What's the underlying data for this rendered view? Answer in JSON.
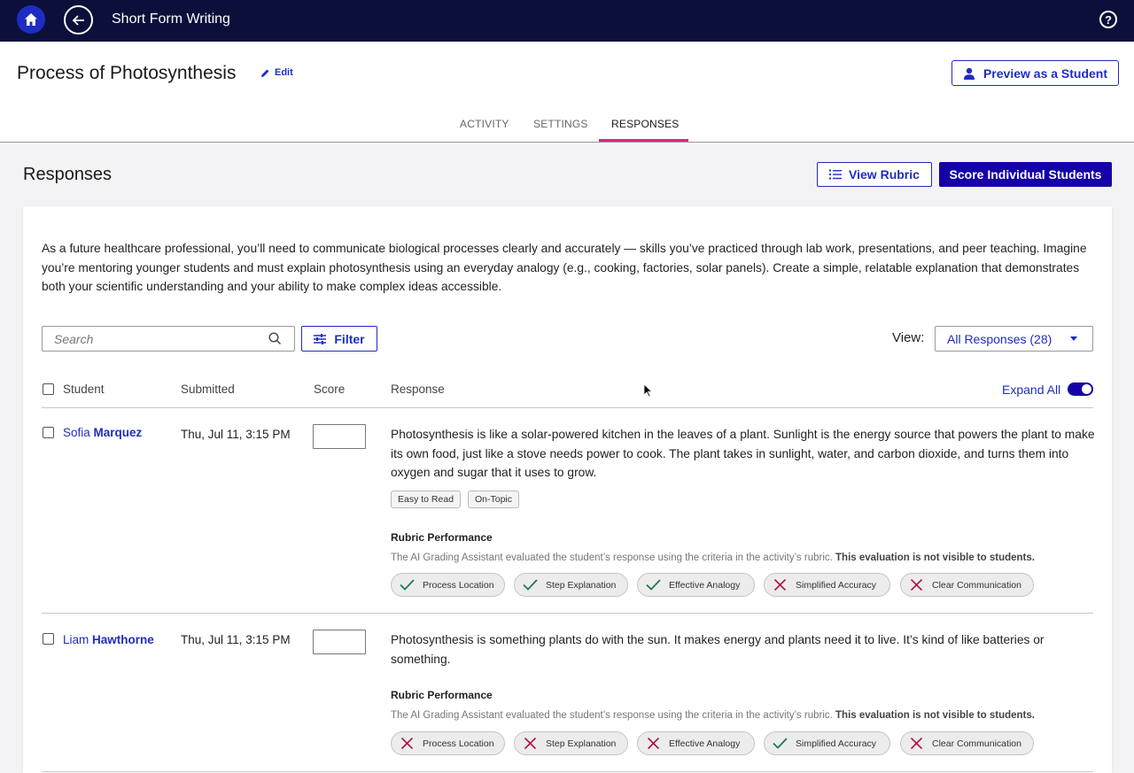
{
  "app": {
    "title": "Short Form Writing"
  },
  "header": {
    "page_title": "Process of Photosynthesis",
    "edit_label": "Edit",
    "preview_label": "Preview as a Student",
    "tabs": [
      {
        "label": "ACTIVITY"
      },
      {
        "label": "SETTINGS"
      },
      {
        "label": "RESPONSES"
      }
    ],
    "active_tab": "RESPONSES"
  },
  "responses": {
    "title": "Responses",
    "view_rubric_label": "View Rubric",
    "score_students_label": "Score Individual Students",
    "prompt": "As a future healthcare professional, you’ll need to communicate biological processes clearly and accurately — skills you’ve practiced through lab work, presentations, and peer teaching. Imagine you’re mentoring younger students and must explain photosynthesis using an everyday analogy (e.g., cooking, factories, solar panels). Create a simple, relatable explanation that demonstrates both your scientific understanding and your ability to make complex ideas accessible.",
    "search_placeholder": "Search",
    "filter_label": "Filter",
    "view_label": "View:",
    "view_value": "All Responses (28)",
    "columns": {
      "student": "Student",
      "submitted": "Submitted",
      "score": "Score",
      "response": "Response"
    },
    "expand_all_label": "Expand All",
    "expand_all_on": true,
    "rubric_title": "Rubric Performance",
    "rubric_desc": "The AI Grading Assistant evaluated the student’s response using the criteria in the activity’s rubric.",
    "rubric_desc_bold": "This evaluation is not visible to students.",
    "colors": {
      "pass": "#1e7a4a",
      "fail": "#b0113e",
      "accent": "#1f2cc2",
      "primary": "#1500a8",
      "tab_underline": "#e0237f"
    },
    "rows": [
      {
        "first": "Sofia",
        "last": "Marquez",
        "submitted": "Thu, Jul 11, 3:15 PM",
        "score": "",
        "text": "Photosynthesis is like a solar-powered kitchen in the leaves of a plant. Sunlight is the energy source that powers the plant to make its own food, just like a stove needs power to cook. The plant takes in sunlight, water, and carbon dioxide, and turns them into oxygen and sugar that it uses to grow.",
        "tags": [
          "Easy to Read",
          "On-Topic"
        ],
        "criteria": [
          {
            "label": "Process Location",
            "pass": true
          },
          {
            "label": "Step Explanation",
            "pass": true
          },
          {
            "label": "Effective Analogy",
            "pass": true
          },
          {
            "label": "Simplified Accuracy",
            "pass": false
          },
          {
            "label": "Clear Communication",
            "pass": false
          }
        ]
      },
      {
        "first": "Liam",
        "last": "Hawthorne",
        "submitted": "Thu, Jul 11, 3:15 PM",
        "score": "",
        "text": "Photosynthesis is something plants do with the sun. It makes energy and plants need it to live. It’s kind of like batteries or something.",
        "tags": [],
        "criteria": [
          {
            "label": "Process Location",
            "pass": false
          },
          {
            "label": "Step Explanation",
            "pass": false
          },
          {
            "label": "Effective Analogy",
            "pass": false
          },
          {
            "label": "Simplified Accuracy",
            "pass": true
          },
          {
            "label": "Clear Communication",
            "pass": false
          }
        ]
      }
    ]
  }
}
